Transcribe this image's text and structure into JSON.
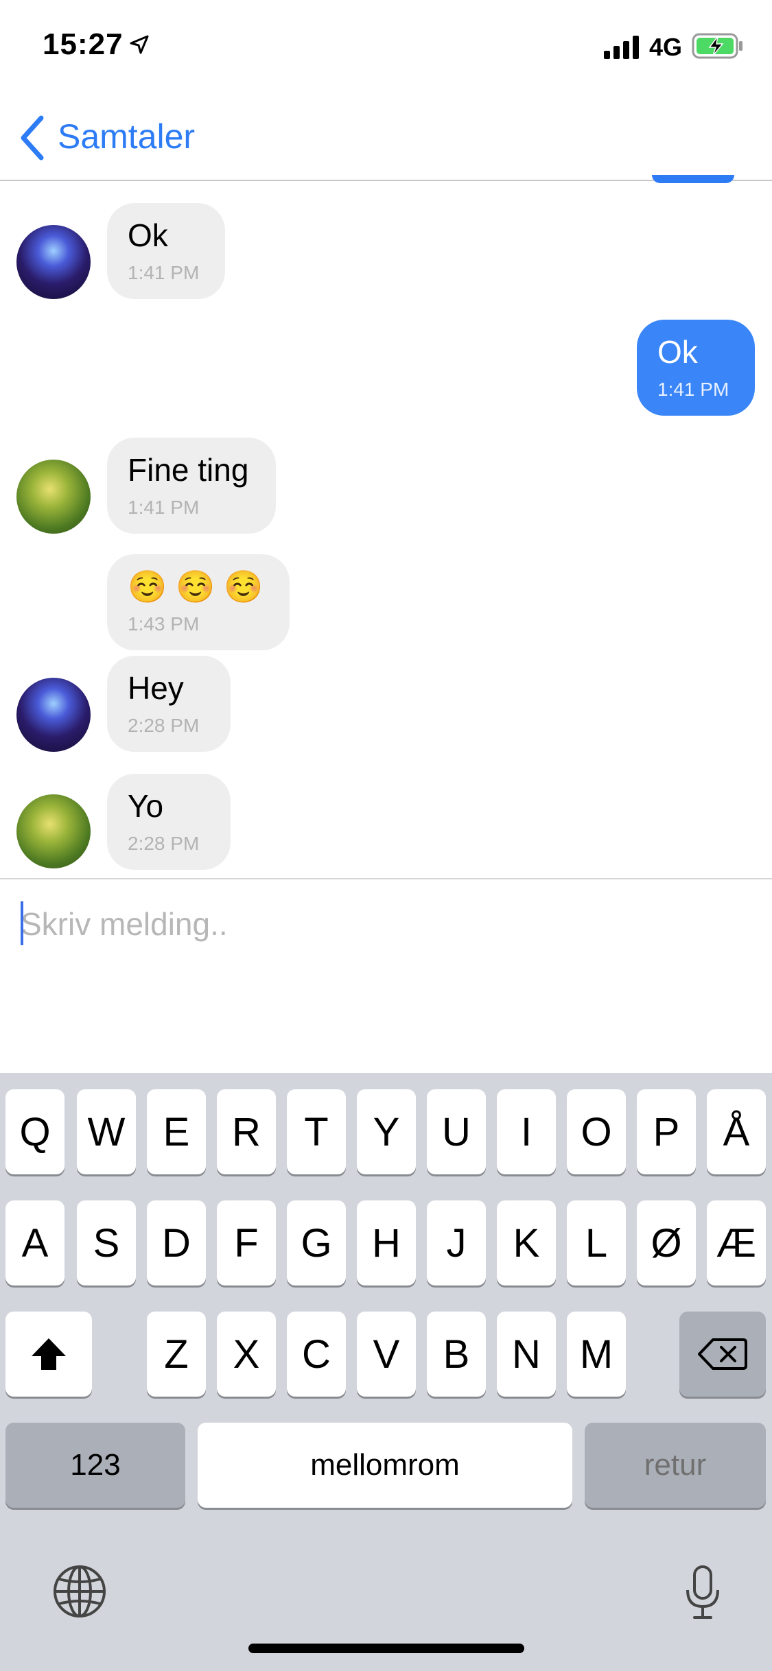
{
  "status_bar": {
    "time": "15:27",
    "network": "4G"
  },
  "nav": {
    "back_label": "Samtaler"
  },
  "messages": [
    {
      "text": "Ok",
      "time": "1:41 PM",
      "direction": "in",
      "avatar": "party"
    },
    {
      "text": "Ok",
      "time": "1:41 PM",
      "direction": "out"
    },
    {
      "text": "Fine ting",
      "time": "1:41 PM",
      "direction": "in",
      "avatar": "leaf"
    },
    {
      "text": "☺️ ☺️ ☺️",
      "time": "1:43 PM",
      "direction": "in"
    },
    {
      "text": "Hey",
      "time": "2:28 PM",
      "direction": "in",
      "avatar": "party"
    },
    {
      "text": "Yo",
      "time": "2:28 PM",
      "direction": "in",
      "avatar": "leaf"
    }
  ],
  "input": {
    "placeholder": "Skriv melding.."
  },
  "keyboard": {
    "row1": [
      "Q",
      "W",
      "E",
      "R",
      "T",
      "Y",
      "U",
      "I",
      "O",
      "P",
      "Å"
    ],
    "row2": [
      "A",
      "S",
      "D",
      "F",
      "G",
      "H",
      "J",
      "K",
      "L",
      "Ø",
      "Æ"
    ],
    "row3": [
      "Z",
      "X",
      "C",
      "V",
      "B",
      "N",
      "M"
    ],
    "numbers_label": "123",
    "space_label": "mellomrom",
    "return_label": "retur"
  },
  "colors": {
    "accent": "#2d7cf6",
    "outgoing_bubble": "#3a86f8",
    "incoming_bubble": "#eeeeee",
    "keyboard_bg": "#d2d5db"
  }
}
